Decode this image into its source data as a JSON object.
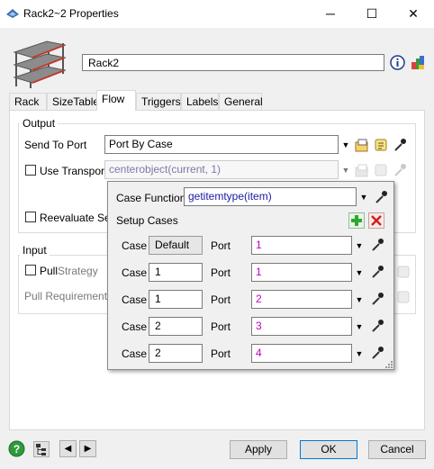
{
  "window": {
    "title": "Rack2~2  Properties",
    "minimize": "─",
    "maximize": "☐",
    "close": "✕"
  },
  "object": {
    "name": "Rack2",
    "icon": "rack-icon"
  },
  "tabs": [
    "Rack",
    "SizeTable",
    "Flow",
    "Triggers",
    "Labels",
    "General"
  ],
  "active_tab": "Flow",
  "output": {
    "label": "Output",
    "send_to_port_label": "Send To Port",
    "send_to_port_value": "Port By Case",
    "use_transport_label": "Use Transport",
    "use_transport_value": "centerobject(current, 1)",
    "reevaluate_label": "Reevaluate Sen"
  },
  "input": {
    "label": "Input",
    "pull_label": "Pull",
    "pull_strategy_label": "Strategy",
    "pull_requirement_label": "Pull Requirement"
  },
  "popup": {
    "case_function_label": "Case Function",
    "case_function_value": "getitemtype(item)",
    "setup_cases_label": "Setup Cases",
    "case_label": "Case",
    "port_label": "Port",
    "cases": [
      {
        "case": "Default",
        "port": "1"
      },
      {
        "case": "1",
        "port": "1"
      },
      {
        "case": "1",
        "port": "2"
      },
      {
        "case": "2",
        "port": "3"
      },
      {
        "case": "2",
        "port": "4"
      }
    ]
  },
  "footer": {
    "apply": "Apply",
    "ok": "OK",
    "cancel": "Cancel",
    "help": "?"
  }
}
